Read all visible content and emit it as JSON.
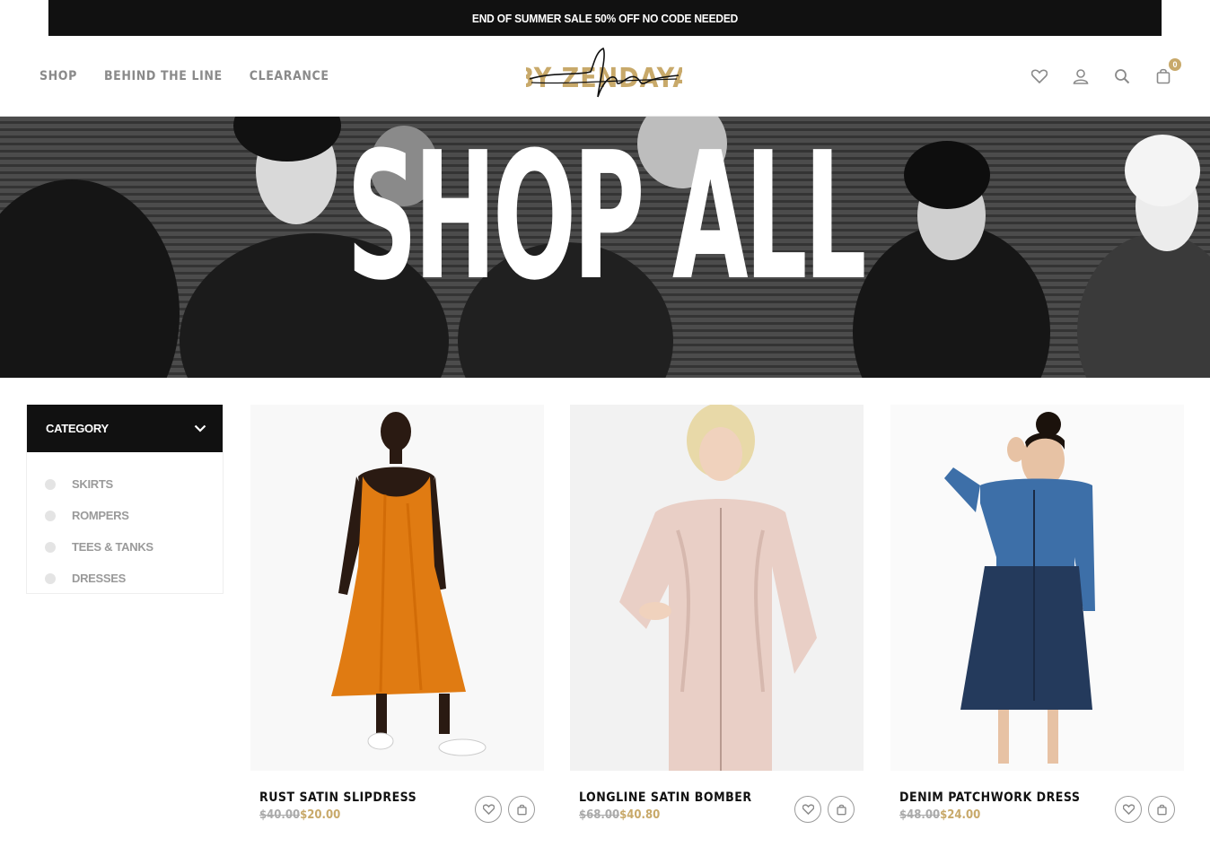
{
  "promo": {
    "text": "END OF SUMMER SALE 50% OFF NO CODE NEEDED"
  },
  "nav": [
    {
      "label": "SHOP"
    },
    {
      "label": "BEHIND THE LINE"
    },
    {
      "label": "CLEARANCE"
    }
  ],
  "logo": {
    "text": "DAYA BY ZENDAYA"
  },
  "header": {
    "cart_count": "0"
  },
  "hero": {
    "title": "SHOP ALL"
  },
  "sidebar": {
    "heading": "CATEGORY",
    "categories": [
      {
        "label": "SKIRTS"
      },
      {
        "label": "ROMPERS"
      },
      {
        "label": "TEES & TANKS"
      },
      {
        "label": "DRESSES"
      }
    ]
  },
  "products": [
    {
      "name": "RUST SATIN SLIPDRESS",
      "old_price": "$40.00",
      "price": "$20.00",
      "garment_color": "#e07b12"
    },
    {
      "name": "LONGLINE SATIN BOMBER",
      "old_price": "$68.00",
      "price": "$40.80",
      "garment_color": "#e9cfc6"
    },
    {
      "name": "DENIM PATCHWORK DRESS",
      "old_price": "$48.00",
      "price": "$24.00",
      "garment_color": "#3d6fa8"
    }
  ],
  "colors": {
    "accent": "#c8a96a",
    "dark": "#111111",
    "muted": "#8a8a8a"
  }
}
